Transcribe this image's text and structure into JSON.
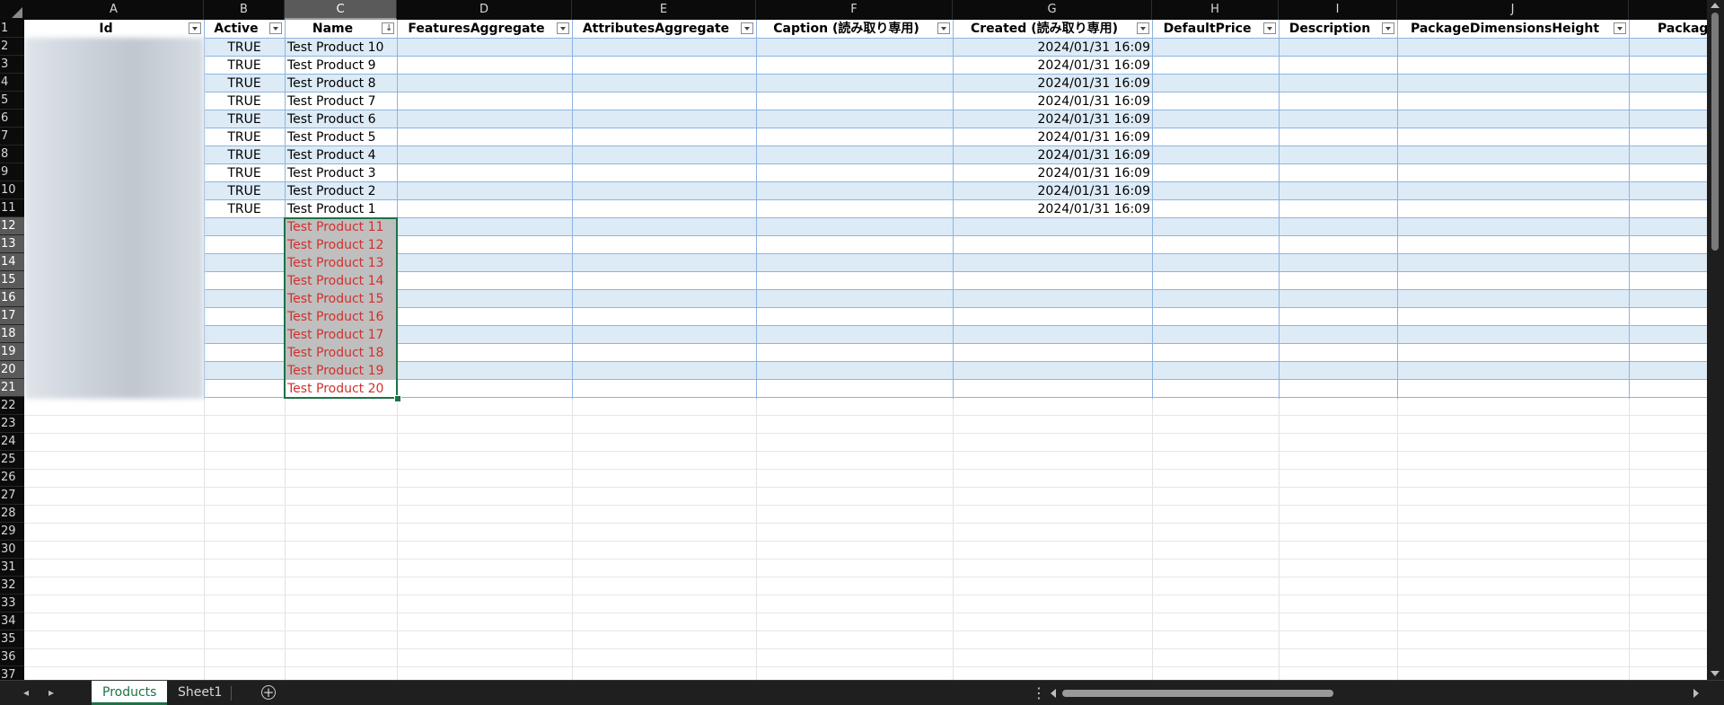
{
  "column_letters": [
    "A",
    "B",
    "C",
    "D",
    "E",
    "F",
    "G",
    "H",
    "I",
    "J"
  ],
  "headers": [
    "Id",
    "Active",
    "Name",
    "FeaturesAggregate",
    "AttributesAggregate",
    "Caption (読み取り専用)",
    "Created (読み取り専用)",
    "DefaultPrice",
    "Description",
    "PackageDimensionsHeight",
    "Packag"
  ],
  "row_numbers": [
    "1",
    "2",
    "3",
    "4",
    "5",
    "6",
    "7",
    "8",
    "9",
    "10",
    "11",
    "12",
    "13",
    "14",
    "15",
    "16",
    "17",
    "18",
    "19",
    "20",
    "21",
    "22",
    "23",
    "24",
    "25",
    "26",
    "27",
    "28",
    "29",
    "30",
    "31",
    "32",
    "33",
    "34",
    "35",
    "36",
    "37"
  ],
  "rows": [
    {
      "active": "TRUE",
      "name": "Test Product 10",
      "created": "2024/01/31 16:09"
    },
    {
      "active": "TRUE",
      "name": "Test Product 9",
      "created": "2024/01/31 16:09"
    },
    {
      "active": "TRUE",
      "name": "Test Product 8",
      "created": "2024/01/31 16:09"
    },
    {
      "active": "TRUE",
      "name": "Test Product 7",
      "created": "2024/01/31 16:09"
    },
    {
      "active": "TRUE",
      "name": "Test Product 6",
      "created": "2024/01/31 16:09"
    },
    {
      "active": "TRUE",
      "name": "Test Product 5",
      "created": "2024/01/31 16:09"
    },
    {
      "active": "TRUE",
      "name": "Test Product 4",
      "created": "2024/01/31 16:09"
    },
    {
      "active": "TRUE",
      "name": "Test Product 3",
      "created": "2024/01/31 16:09"
    },
    {
      "active": "TRUE",
      "name": "Test Product 2",
      "created": "2024/01/31 16:09"
    },
    {
      "active": "TRUE",
      "name": "Test Product 1",
      "created": "2024/01/31 16:09"
    }
  ],
  "new_rows": [
    "Test Product 11",
    "Test Product 12",
    "Test Product 13",
    "Test Product 14",
    "Test Product 15",
    "Test Product 16",
    "Test Product 17",
    "Test Product 18",
    "Test Product 19",
    "Test Product 20"
  ],
  "sheet_tabs": [
    {
      "label": "Products",
      "active": true
    },
    {
      "label": "Sheet1",
      "active": false
    }
  ],
  "add_sheet_glyph": "+",
  "menu_glyph": "⋮",
  "selected_column": "C",
  "colors": {
    "table_band": "#ddebf7",
    "selection": "#1e7145",
    "new_text": "#d0312d"
  }
}
